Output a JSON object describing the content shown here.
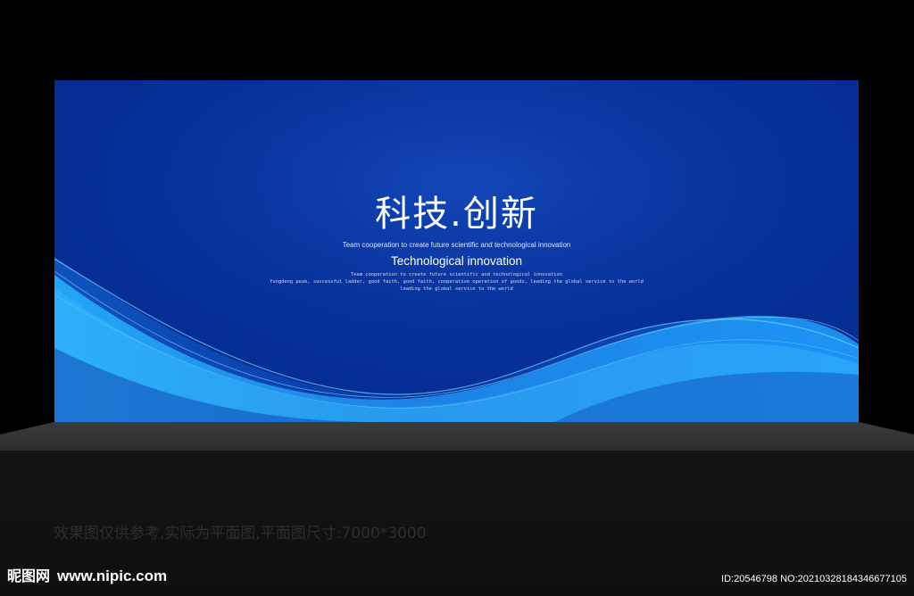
{
  "backdrop": {
    "title": "科技.创新",
    "subtitle": "Team cooperation to create future scientific and technological innovation",
    "tagline": "Technological innovation",
    "small_line_1": "Team cooperation to create future scientific and technological innovation",
    "small_line_2": "Yongdeng peak, successful ladder, good faith, good faith, cooperative operation of goods, leading the global service to the world",
    "small_line_3": "leading the global service to the world"
  },
  "caption": "效果图仅供参考,实际为平面图,平面图尺寸:7000*3000",
  "watermark": {
    "brand": "昵图网",
    "url": "www.nipic.com",
    "image_id": "ID:20546798 NO:20210328184346677105"
  },
  "colors": {
    "background": "#000000",
    "backdrop_blue": "#06309a",
    "wave_blue": "#2aa8ff",
    "stage_grey": "#3a3a3a"
  }
}
